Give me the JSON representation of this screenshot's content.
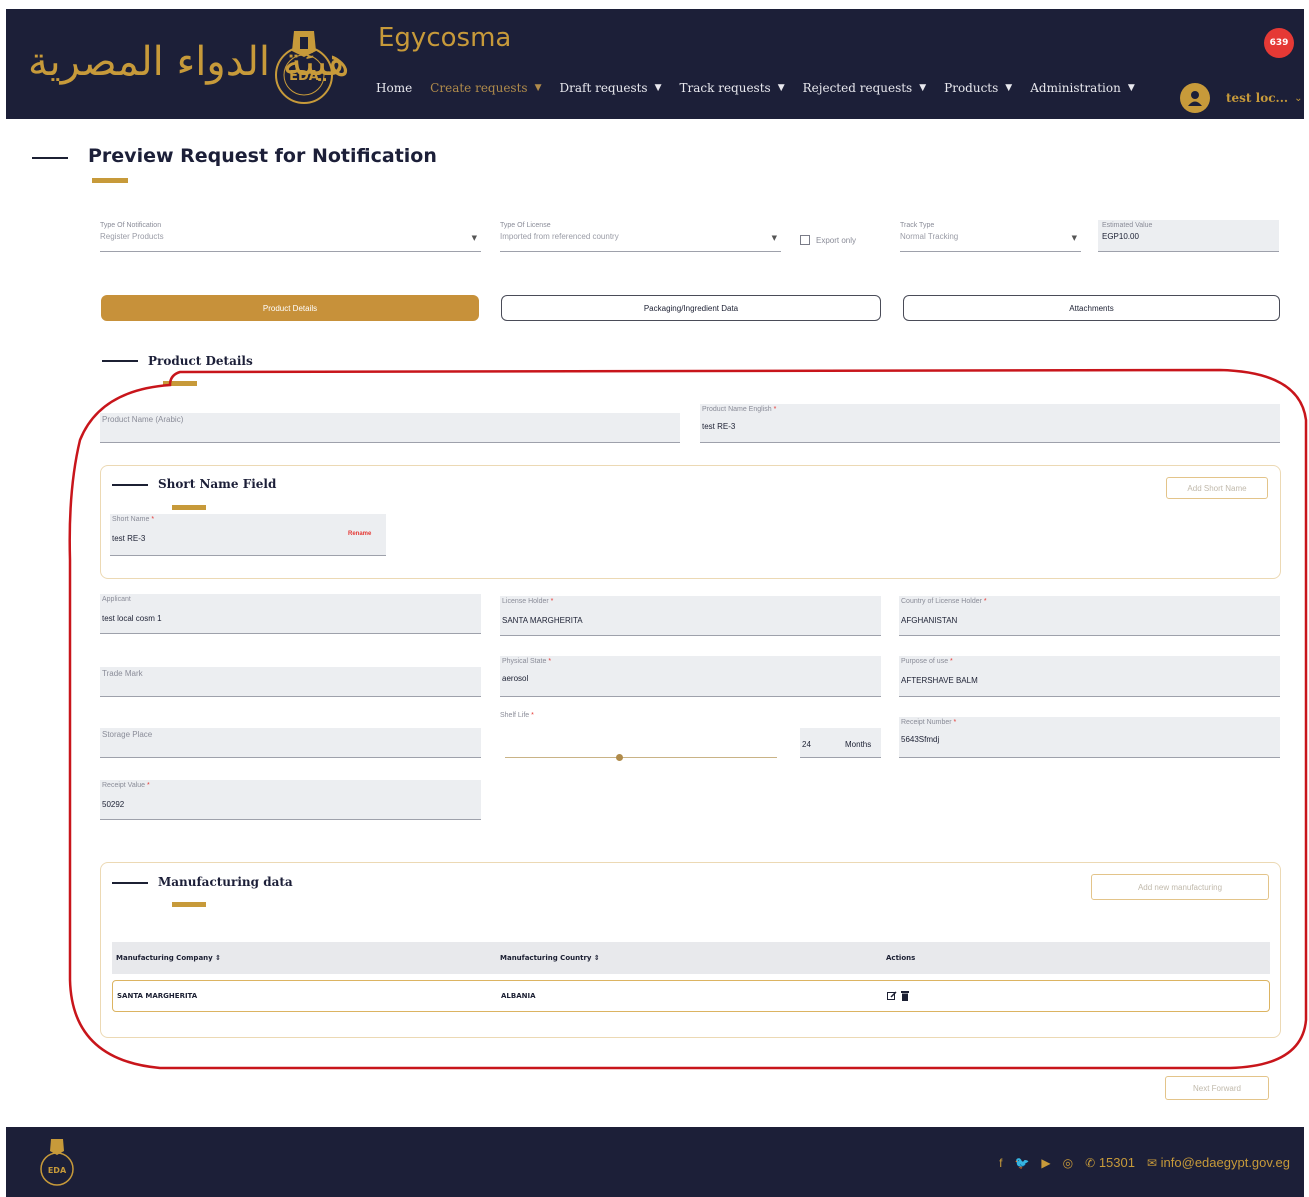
{
  "header": {
    "brand_arabic": "هيئة الدواء المصرية",
    "app_title": "Egycosma",
    "notification_count": "639",
    "user_name": "test loc...",
    "nav": [
      {
        "label": "Home",
        "active": false,
        "dropdown": false
      },
      {
        "label": "Create requests",
        "active": true,
        "dropdown": true
      },
      {
        "label": "Draft requests",
        "active": false,
        "dropdown": true
      },
      {
        "label": "Track requests",
        "active": false,
        "dropdown": true
      },
      {
        "label": "Rejected requests",
        "active": false,
        "dropdown": true
      },
      {
        "label": "Products",
        "active": false,
        "dropdown": true
      },
      {
        "label": "Administration",
        "active": false,
        "dropdown": true
      }
    ]
  },
  "page_title": "Preview Request for Notification",
  "top_fields": {
    "notification_type": {
      "label": "Type Of Notification",
      "value": "Register Products"
    },
    "license_type": {
      "label": "Type Of License",
      "value": "Imported from referenced country"
    },
    "export_only": "Export only",
    "track_type": {
      "label": "Track Type",
      "value": "Normal Tracking"
    },
    "estimated_value": {
      "label": "Estimated Value",
      "value": "EGP10.00"
    }
  },
  "tabs": {
    "product_details": "Product Details",
    "packaging": "Packaging/Ingredient Data",
    "attachments": "Attachments"
  },
  "product_details": {
    "section_title": "Product Details",
    "product_name_arabic": {
      "label": "Product Name (Arabic)",
      "value": ""
    },
    "product_name_english": {
      "label": "Product Name English",
      "value": "test RE-3"
    },
    "short_name_section": "Short Name Field",
    "add_short_name": "Add Short Name",
    "short_name": {
      "label": "Short Name",
      "value": "test RE-3"
    },
    "rename_label": "Rename",
    "applicant": {
      "label": "Applicant",
      "value": "test local cosm 1"
    },
    "license_holder": {
      "label": "License Holder",
      "value": "SANTA MARGHERITA"
    },
    "country_license_holder": {
      "label": "Country of License Holder",
      "value": "AFGHANISTAN"
    },
    "trade_mark": {
      "label": "Trade Mark",
      "value": ""
    },
    "physical_state": {
      "label": "Physical State",
      "value": "aerosol"
    },
    "purpose_of_use": {
      "label": "Purpose of use",
      "value": "AFTERSHAVE BALM"
    },
    "storage_place": {
      "label": "Storage Place",
      "value": ""
    },
    "shelf_life": {
      "label": "Shelf Life",
      "value": "24",
      "unit": "Months",
      "fraction": 0.42
    },
    "receipt_number": {
      "label": "Receipt Number",
      "value": "5643Sfmdj"
    },
    "receipt_value": {
      "label": "Receipt Value",
      "value": "50292"
    }
  },
  "manufacturing": {
    "section_title": "Manufacturing data",
    "add_button": "Add new manufacturing",
    "columns": [
      "Manufacturing Company ⇕",
      "Manufacturing Country ⇕",
      "Actions"
    ],
    "rows": [
      {
        "company": "SANTA MARGHERITA",
        "country": "ALBANIA"
      }
    ]
  },
  "next_button": "Next Forward",
  "footer": {
    "phone": "15301",
    "email": "info@edaegypt.gov.eg"
  }
}
